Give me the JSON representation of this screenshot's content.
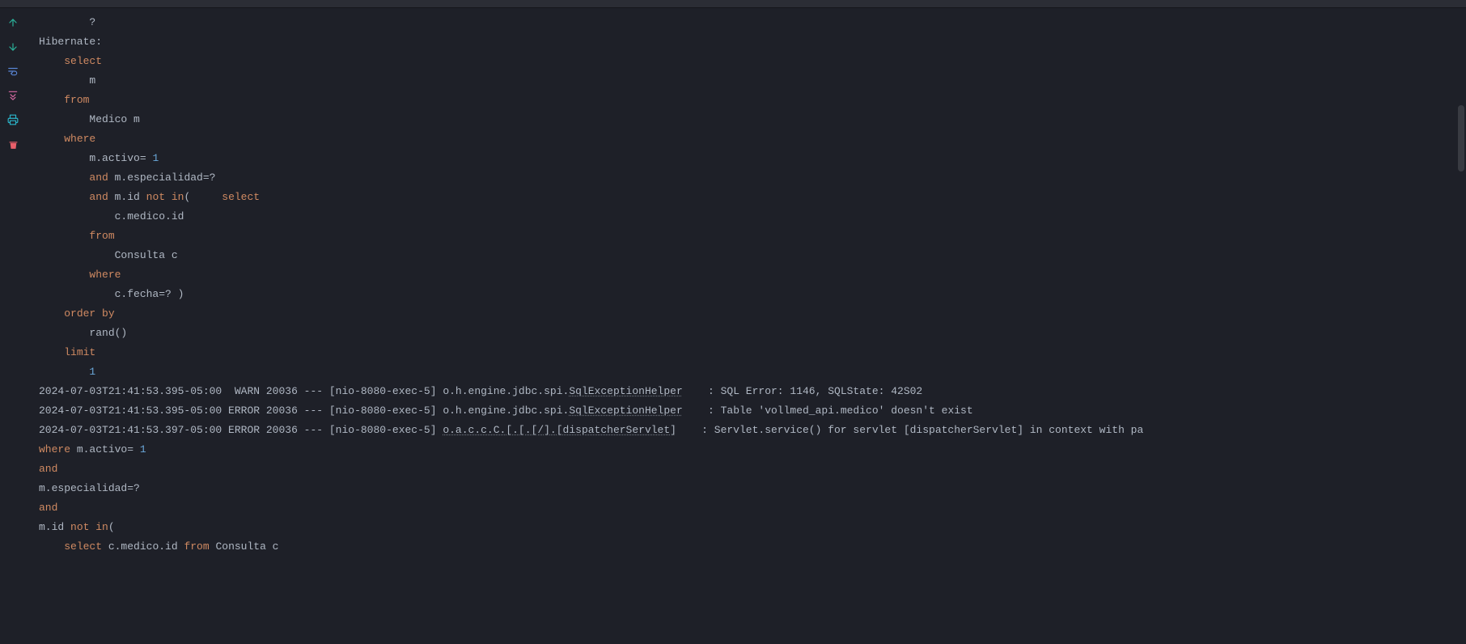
{
  "gutter": {
    "up": "arrow-up",
    "down": "arrow-down",
    "softwrap": "soft-wrap",
    "scrollend": "scroll-to-end",
    "print": "print",
    "clear": "clear-all"
  },
  "lines": [
    {
      "t": "plain",
      "indent": 8,
      "text": "?"
    },
    {
      "t": "plain",
      "indent": 0,
      "text": "Hibernate:"
    },
    {
      "t": "kw",
      "indent": 4,
      "text": "select"
    },
    {
      "t": "plain",
      "indent": 8,
      "text": "m"
    },
    {
      "t": "kw",
      "indent": 4,
      "text": "from"
    },
    {
      "t": "plain",
      "indent": 8,
      "text": "Medico m"
    },
    {
      "t": "kw",
      "indent": 4,
      "text": "where"
    },
    {
      "t": "mixed",
      "indent": 8,
      "parts": [
        {
          "c": "plain",
          "v": "m.activo= "
        },
        {
          "c": "num",
          "v": "1"
        }
      ]
    },
    {
      "t": "mixed",
      "indent": 8,
      "parts": [
        {
          "c": "kw",
          "v": "and"
        },
        {
          "c": "plain",
          "v": " m.especialidad=?"
        }
      ]
    },
    {
      "t": "mixed",
      "indent": 8,
      "parts": [
        {
          "c": "kw",
          "v": "and"
        },
        {
          "c": "plain",
          "v": " m.id "
        },
        {
          "c": "kw",
          "v": "not"
        },
        {
          "c": "plain",
          "v": " "
        },
        {
          "c": "kw",
          "v": "in"
        },
        {
          "c": "plain",
          "v": "(     "
        },
        {
          "c": "kw",
          "v": "select"
        }
      ]
    },
    {
      "t": "plain",
      "indent": 12,
      "text": "c.medico.id"
    },
    {
      "t": "kw",
      "indent": 8,
      "text": "from"
    },
    {
      "t": "plain",
      "indent": 12,
      "text": "Consulta c"
    },
    {
      "t": "kw",
      "indent": 8,
      "text": "where"
    },
    {
      "t": "plain",
      "indent": 12,
      "text": "c.fecha=? )"
    },
    {
      "t": "kw",
      "indent": 4,
      "text": "order by"
    },
    {
      "t": "plain",
      "indent": 8,
      "text": "rand()"
    },
    {
      "t": "kw",
      "indent": 4,
      "text": "limit"
    },
    {
      "t": "num",
      "indent": 8,
      "text": "1"
    },
    {
      "t": "log",
      "ts": "2024-07-03T21:41:53.395-05:00",
      "level": " WARN",
      "pid": "20036",
      "thread": "[nio-8080-exec-5]",
      "logger_pre": "o.h.engine.jdbc.spi.",
      "logger_u": "SqlExceptionHelper",
      "pad": "   ",
      "msg": "SQL Error: 1146, SQLState: 42S02"
    },
    {
      "t": "log",
      "ts": "2024-07-03T21:41:53.395-05:00",
      "level": "ERROR",
      "pid": "20036",
      "thread": "[nio-8080-exec-5]",
      "logger_pre": "o.h.engine.jdbc.spi.",
      "logger_u": "SqlExceptionHelper",
      "pad": "   ",
      "msg": "Table 'vollmed_api.medico' doesn't exist"
    },
    {
      "t": "log",
      "ts": "2024-07-03T21:41:53.397-05:00",
      "level": "ERROR",
      "pid": "20036",
      "thread": "[nio-8080-exec-5]",
      "logger_pre": "",
      "logger_u": "o.a.c.c.C.[.[.[/].[dispatcherServlet]",
      "pad": "   ",
      "msg": "Servlet.service() for servlet [dispatcherServlet] in context with pa"
    },
    {
      "t": "mixed",
      "indent": 0,
      "parts": [
        {
          "c": "kw",
          "v": "where"
        },
        {
          "c": "plain",
          "v": " m.activo= "
        },
        {
          "c": "num",
          "v": "1"
        }
      ]
    },
    {
      "t": "kw",
      "indent": 0,
      "text": "and"
    },
    {
      "t": "plain",
      "indent": 0,
      "text": "m.especialidad=?"
    },
    {
      "t": "kw",
      "indent": 0,
      "text": "and"
    },
    {
      "t": "mixed",
      "indent": 0,
      "parts": [
        {
          "c": "plain",
          "v": "m.id "
        },
        {
          "c": "kw",
          "v": "not"
        },
        {
          "c": "plain",
          "v": " "
        },
        {
          "c": "kw",
          "v": "in"
        },
        {
          "c": "plain",
          "v": "("
        }
      ]
    },
    {
      "t": "mixed",
      "indent": 4,
      "parts": [
        {
          "c": "kw",
          "v": "select"
        },
        {
          "c": "plain",
          "v": " c.medico.id "
        },
        {
          "c": "kw",
          "v": "from"
        },
        {
          "c": "plain",
          "v": " Consulta c"
        }
      ]
    }
  ]
}
